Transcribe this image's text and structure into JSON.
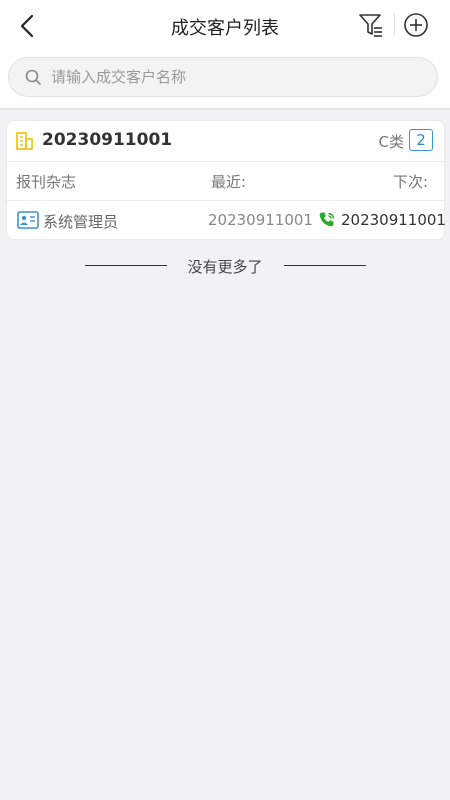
{
  "header": {
    "title": "成交客户列表",
    "back_icon": "chevron-left-icon",
    "filter_icon": "filter-icon",
    "add_icon": "plus-circle-icon"
  },
  "search": {
    "placeholder": "请输入成交客户名称",
    "value": ""
  },
  "customers": [
    {
      "id": "20230911001",
      "category": "C类",
      "count": "2",
      "magazine": "报刊杂志",
      "recent_label": "最近:",
      "next_label": "下次:",
      "owner": "系统管理员",
      "recent_value": "20230911001",
      "next_value": "20230911001"
    }
  ],
  "list_footer": {
    "no_more": "没有更多了"
  },
  "colors": {
    "accent": "#3c93d9",
    "phone": "#2aa82a",
    "building": "#f2c000",
    "background": "#f1f2f4"
  }
}
